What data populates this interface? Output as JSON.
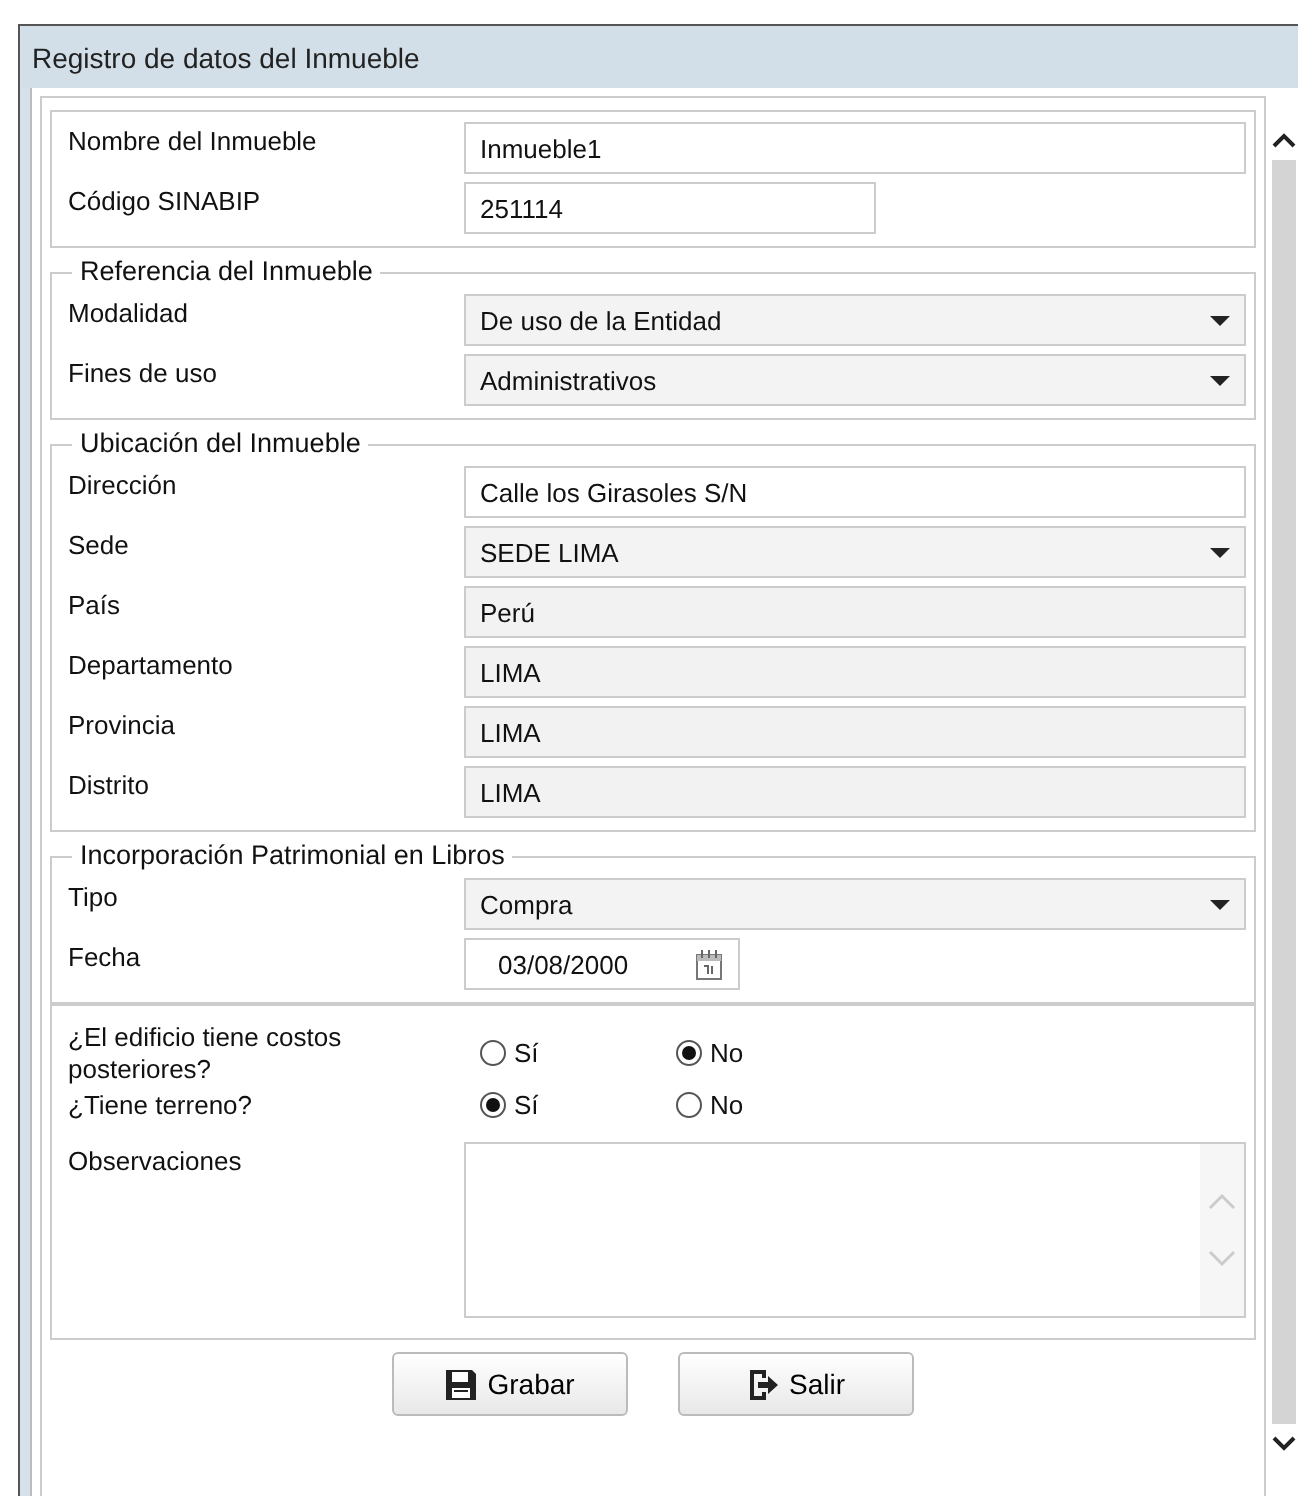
{
  "window": {
    "title": "Registro de datos del Inmueble"
  },
  "sections": [
    {
      "fields": [
        {
          "label": "Nombre del Inmueble",
          "kind": "text",
          "value": "Inmueble1"
        },
        {
          "label": "Código SINABIP",
          "kind": "short-text",
          "value": "251114"
        }
      ]
    },
    {
      "legend": "Referencia del Inmueble",
      "fields": [
        {
          "label": "Modalidad",
          "kind": "select",
          "value": "De uso de la Entidad"
        },
        {
          "label": "Fines de uso",
          "kind": "select",
          "value": "Administrativos"
        }
      ]
    },
    {
      "legend": "Ubicación del Inmueble",
      "fields": [
        {
          "label": "Dirección",
          "kind": "text",
          "value": "Calle los Girasoles S/N"
        },
        {
          "label": "Sede",
          "kind": "select",
          "value": "SEDE LIMA"
        },
        {
          "label": "País",
          "kind": "readonly",
          "value": "Perú"
        },
        {
          "label": "Departamento",
          "kind": "readonly",
          "value": "LIMA"
        },
        {
          "label": "Provincia",
          "kind": "readonly",
          "value": "LIMA"
        },
        {
          "label": "Distrito",
          "kind": "readonly",
          "value": "LIMA"
        }
      ]
    },
    {
      "legend": "Incorporación Patrimonial en Libros",
      "fields": [
        {
          "label": "Tipo",
          "kind": "select",
          "value": "Compra"
        },
        {
          "label": "Fecha",
          "kind": "date",
          "value": "03/08/2000"
        }
      ]
    }
  ],
  "questions": [
    {
      "label": "¿El edificio tiene costos posteriores?",
      "options": [
        {
          "label": "Sí",
          "selected": false
        },
        {
          "label": "No",
          "selected": true
        }
      ]
    },
    {
      "label": "¿Tiene terreno?",
      "options": [
        {
          "label": "Sí",
          "selected": true
        },
        {
          "label": "No",
          "selected": false
        }
      ]
    }
  ],
  "observations": {
    "label": "Observaciones"
  },
  "buttons": [
    {
      "label": "Grabar",
      "kind": "save"
    },
    {
      "label": "Salir",
      "kind": "exit"
    }
  ]
}
